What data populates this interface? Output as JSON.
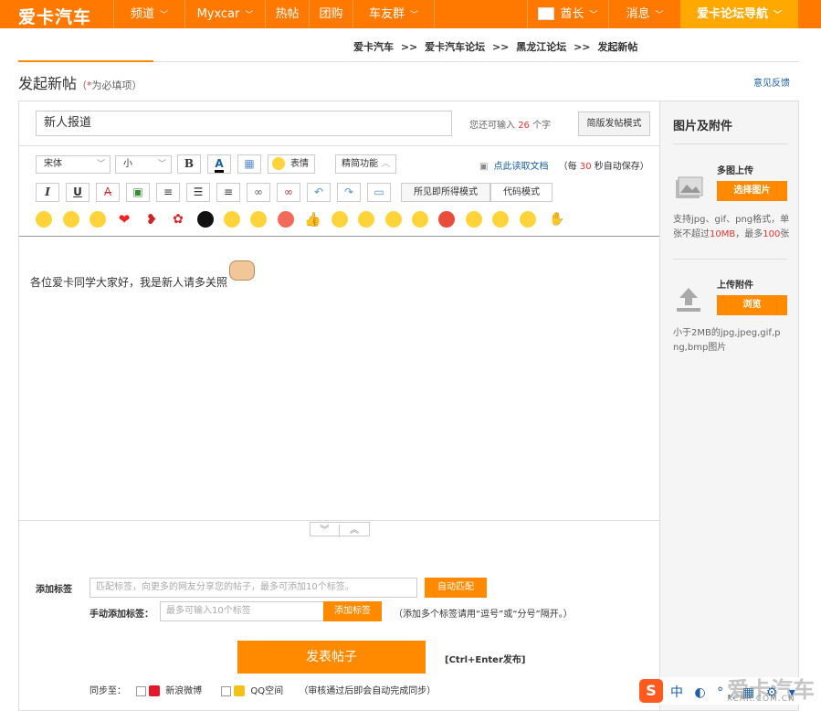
{
  "nav": {
    "logo": "爱卡汽车",
    "items": [
      {
        "label": "频道"
      },
      {
        "label": "Myxcar"
      },
      {
        "label": "热帖"
      },
      {
        "label": "团购"
      },
      {
        "label": "车友群"
      }
    ],
    "user": "酋长",
    "messages": "消息",
    "forum_nav": "爱卡论坛导航",
    "brand_color": "#ff7800"
  },
  "breadcrumb": {
    "items": [
      "爱卡汽车",
      "爱卡汽车论坛",
      "黑龙江论坛",
      "发起新帖"
    ],
    "sep": ">>"
  },
  "page": {
    "title": "发起新帖",
    "required_open": "（",
    "required_star": "*",
    "required_text": "为必填项）",
    "feedback": "意见反馈"
  },
  "editor": {
    "subject_value": "新人报道",
    "remain_prefix": "您还可输入",
    "remain_count": "26",
    "remain_suffix": "个字",
    "simple_mode": "简版发帖模式",
    "font_family": "宋体",
    "font_size": "小",
    "emoji_label": "表情",
    "fine_func": "精简功能",
    "autosave_link": "点此读取文档",
    "autosave_prefix": "（每",
    "autosave_n": "30",
    "autosave_suffix": "秒自动保存）",
    "wysiwyg": "所见即所得模式",
    "code_mode": "代码模式",
    "content": "各位爱卡同学大家好，我是新人请多关照"
  },
  "tags": {
    "label": "添加标签",
    "placeholder": "匹配标签，向更多的网友分享您的帖子，最多可添加10个标签。",
    "auto_btn": "自动匹配",
    "manual_label": "手动添加标签：",
    "manual_placeholder": "最多可输入10个标签",
    "add_btn": "添加标签",
    "hint": "（添加多个标签请用“逗号”或“分号”隔开。）"
  },
  "publish": {
    "button": "发表帖子",
    "hotkey": "[Ctrl+Enter发布]",
    "sync_label": "同步至：",
    "weibo": "新浪微博",
    "qzone": "QQ空间",
    "sync_note": "（审核通过后即会自动完成同步）"
  },
  "sidebar": {
    "title": "图片及附件",
    "multi_upload": "多图上传",
    "select_images": "选择图片",
    "image_desc_1": "支持jpg、gif、png格式，单张不超过",
    "image_desc_size": "10MB",
    "image_desc_2": "，最多",
    "image_desc_count": "100",
    "image_desc_3": "张",
    "attach_upload": "上传附件",
    "browse": "浏览",
    "attach_desc": "小于2MB的jpg,jpeg,gif,png,bmp图片"
  },
  "ime": {
    "brand": "S",
    "items": "中 ◐ °, ▦ ⚙ ▾"
  },
  "watermark": {
    "text": "爱卡汽车",
    "sub": "XCAR.COM.CN"
  }
}
